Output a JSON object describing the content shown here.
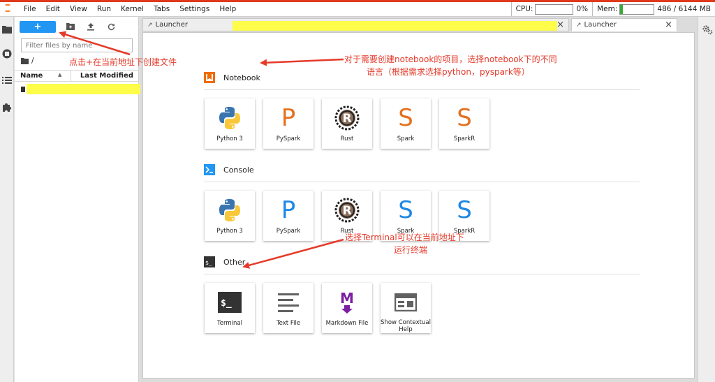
{
  "menubar": {
    "items": [
      "File",
      "Edit",
      "View",
      "Run",
      "Kernel",
      "Tabs",
      "Settings",
      "Help"
    ],
    "cpu_label": "CPU:",
    "cpu_value": "0%",
    "mem_label": "Mem:",
    "mem_value": "486 / 6144 MB",
    "mem_fraction": 0.08
  },
  "filebrowser": {
    "new_label": "+",
    "filter_placeholder": "Filter files by name",
    "breadcrumb": "/",
    "col_name": "Name",
    "col_modified": "Last Modified"
  },
  "tabs": [
    {
      "label": "Launcher"
    },
    {
      "label": "Launcher"
    }
  ],
  "launcher": {
    "notebook": {
      "title": "Notebook",
      "cards": [
        {
          "label": "Python 3"
        },
        {
          "label": "PySpark",
          "letter": "P"
        },
        {
          "label": "Rust"
        },
        {
          "label": "Spark",
          "letter": "S"
        },
        {
          "label": "SparkR",
          "letter": "S"
        }
      ]
    },
    "console": {
      "title": "Console",
      "cards": [
        {
          "label": "Python 3"
        },
        {
          "label": "PySpark",
          "letter": "P"
        },
        {
          "label": "Rust"
        },
        {
          "label": "Spark",
          "letter": "S"
        },
        {
          "label": "SparkR",
          "letter": "S"
        }
      ]
    },
    "other": {
      "title": "Other",
      "cards": [
        {
          "label": "Terminal"
        },
        {
          "label": "Text File"
        },
        {
          "label": "Markdown File"
        },
        {
          "label": "Show Contextual Help"
        }
      ]
    }
  },
  "annotations": {
    "create_file": "点击+在当前地址下创建文件",
    "notebook_line1": "对于需要创建notebook的项目，选择notebook下的不同",
    "notebook_line2": "语言（根据需求选择python，pyspark等）",
    "terminal_line1": "选择Terminal可以在当前地址下",
    "terminal_line2": "运行终端"
  },
  "colors": {
    "accent": "#2196f3",
    "annotation": "#e53a2a",
    "highlight": "#fdfd4a",
    "spark_orange": "#e4711f",
    "pyspark_blue": "#1e88e5",
    "markdown_purple": "#7b1fa2"
  }
}
